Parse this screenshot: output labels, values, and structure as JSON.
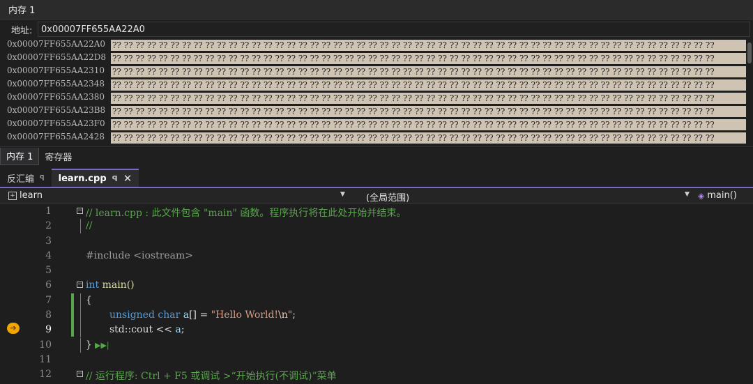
{
  "memory": {
    "window_title": "内存 1",
    "address_label": "地址:",
    "address_value": "0x00007FF655AA22A0",
    "rows": [
      {
        "addr": "0x00007FF655AA22A0"
      },
      {
        "addr": "0x00007FF655AA22D8"
      },
      {
        "addr": "0x00007FF655AA2310"
      },
      {
        "addr": "0x00007FF655AA2348"
      },
      {
        "addr": "0x00007FF655AA2380"
      },
      {
        "addr": "0x00007FF655AA23B8"
      },
      {
        "addr": "0x00007FF655AA23F0"
      },
      {
        "addr": "0x00007FF655AA2428"
      }
    ],
    "byte_text": "?? ?? ?? ?? ?? ?? ?? ?? ?? ?? ?? ?? ?? ?? ?? ?? ?? ?? ?? ?? ?? ?? ?? ?? ?? ?? ?? ?? ?? ?? ?? ?? ?? ?? ?? ?? ?? ?? ?? ?? ?? ?? ?? ?? ?? ?? ?? ?? ?? ?? ?? ??",
    "tabs": [
      "内存 1",
      "寄存器"
    ]
  },
  "editor": {
    "tab_disasm": "反汇编",
    "tab_file": "learn.cpp",
    "pin_glyph": "ꟼ",
    "close_glyph": "✕",
    "nav_project": "learn",
    "nav_scope": "(全局范围)",
    "nav_func": "main()",
    "lines": [
      {
        "n": "1",
        "text": "// learn.cpp : 此文件包含 \"main\" 函数。程序执行将在此处开始并结束。"
      },
      {
        "n": "2",
        "text": "//"
      },
      {
        "n": "3",
        "text": ""
      },
      {
        "n": "4",
        "text": "#include <iostream>"
      },
      {
        "n": "5",
        "text": ""
      },
      {
        "n": "6",
        "kw": "int",
        "rest": " main()"
      },
      {
        "n": "7",
        "text": "{"
      },
      {
        "n": "8",
        "kw": "unsigned char",
        "var": " a",
        "mid": "[] = ",
        "str": "\"Hello World!",
        "esc": "\\n",
        "str2": "\"",
        "end": ";"
      },
      {
        "n": "9",
        "pre": "std::cout << ",
        "var": "a",
        "end": ";"
      },
      {
        "n": "10",
        "text": "}"
      },
      {
        "n": "11",
        "text": ""
      },
      {
        "n": "12",
        "text": "// 运行程序: Ctrl + F5 或调试 >“开始执行(不调试)”菜单"
      }
    ]
  }
}
